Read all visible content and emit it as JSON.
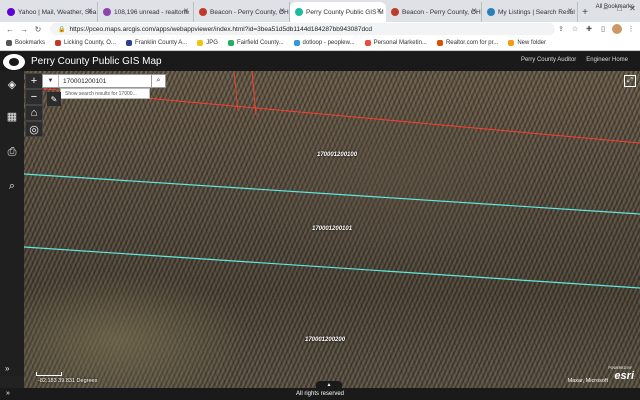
{
  "browser": {
    "tabs": [
      {
        "label": "Yahoo | Mail, Weather, Sea",
        "color": "#6001d2",
        "active": false
      },
      {
        "label": "108,196 unread - realtorte",
        "color": "#8e44ad",
        "active": false
      },
      {
        "label": "Beacon - Perry County, OH",
        "color": "#c0392b",
        "active": false
      },
      {
        "label": "Perry County Public GIS M",
        "color": "#1abc9c",
        "active": true
      },
      {
        "label": "Beacon - Perry County, OH",
        "color": "#c0392b",
        "active": false
      },
      {
        "label": "My Listings | Search Resul",
        "color": "#2980b9",
        "active": false
      }
    ],
    "url": "https://pceo.maps.arcgis.com/apps/webappviewer/index.html?id=3bea51d5db1144d184287bb943087dcd",
    "bookmarks": [
      {
        "label": "Bookmarks",
        "color": "#555"
      },
      {
        "label": "Licking County, O...",
        "color": "#c0392b"
      },
      {
        "label": "Franklin County A...",
        "color": "#2c3e91"
      },
      {
        "label": "JPG",
        "color": "#f1c40f"
      },
      {
        "label": "Fairfield County...",
        "color": "#27ae60"
      },
      {
        "label": "dotloop - peoplew...",
        "color": "#3498db"
      },
      {
        "label": "Personal Marketin...",
        "color": "#e74c3c"
      },
      {
        "label": "Realtor.com for pr...",
        "color": "#d35400"
      },
      {
        "label": "New folder",
        "color": "#f39c12"
      }
    ],
    "all_bookmarks": "All Bookmarks"
  },
  "gis": {
    "title": "Perry County Public GIS Map",
    "links": [
      "Perry County Auditor",
      "Engineer Home"
    ],
    "search": {
      "value": "170001200101",
      "suggestion": "Show search results for 17000..."
    },
    "parcels": [
      {
        "id": "170001200100"
      },
      {
        "id": "170001200101"
      },
      {
        "id": "170001200200"
      }
    ],
    "coordinates": "-82.183 39.831 Degrees",
    "attribution": "Maxar, Microsoft",
    "esri_powered": "POWERED BY",
    "esri": "esri",
    "footer": "All rights reserved"
  }
}
